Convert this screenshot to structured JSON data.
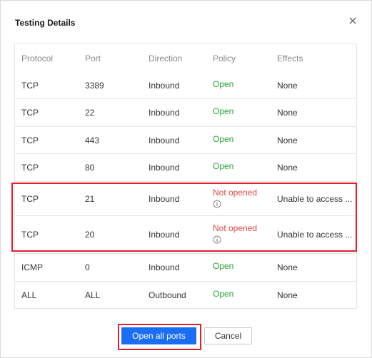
{
  "dialog": {
    "title": "Testing Details",
    "close_icon": "close-icon"
  },
  "table": {
    "headers": [
      "Protocol",
      "Port",
      "Direction",
      "Policy",
      "Effects"
    ],
    "rows": [
      {
        "protocol": "TCP",
        "port": "3389",
        "direction": "Inbound",
        "policy": "Open",
        "effects": "None"
      },
      {
        "protocol": "TCP",
        "port": "22",
        "direction": "Inbound",
        "policy": "Open",
        "effects": "None"
      },
      {
        "protocol": "TCP",
        "port": "443",
        "direction": "Inbound",
        "policy": "Open",
        "effects": "None"
      },
      {
        "protocol": "TCP",
        "port": "80",
        "direction": "Inbound",
        "policy": "Open",
        "effects": "None"
      },
      {
        "protocol": "TCP",
        "port": "21",
        "direction": "Inbound",
        "policy": "Not opened",
        "effects": "Unable to access ..."
      },
      {
        "protocol": "TCP",
        "port": "20",
        "direction": "Inbound",
        "policy": "Not opened",
        "effects": "Unable to access ..."
      },
      {
        "protocol": "ICMP",
        "port": "0",
        "direction": "Inbound",
        "policy": "Open",
        "effects": "None"
      },
      {
        "protocol": "ALL",
        "port": "ALL",
        "direction": "Outbound",
        "policy": "Open",
        "effects": "None"
      }
    ]
  },
  "buttons": {
    "open_all_ports": "Open all ports",
    "cancel": "Cancel"
  },
  "colors": {
    "open": "#29a33b",
    "not_opened": "#e54545",
    "primary": "#1a6ef5",
    "highlight": "#e01f2d"
  },
  "icons": {
    "info": "info-circle-icon"
  }
}
